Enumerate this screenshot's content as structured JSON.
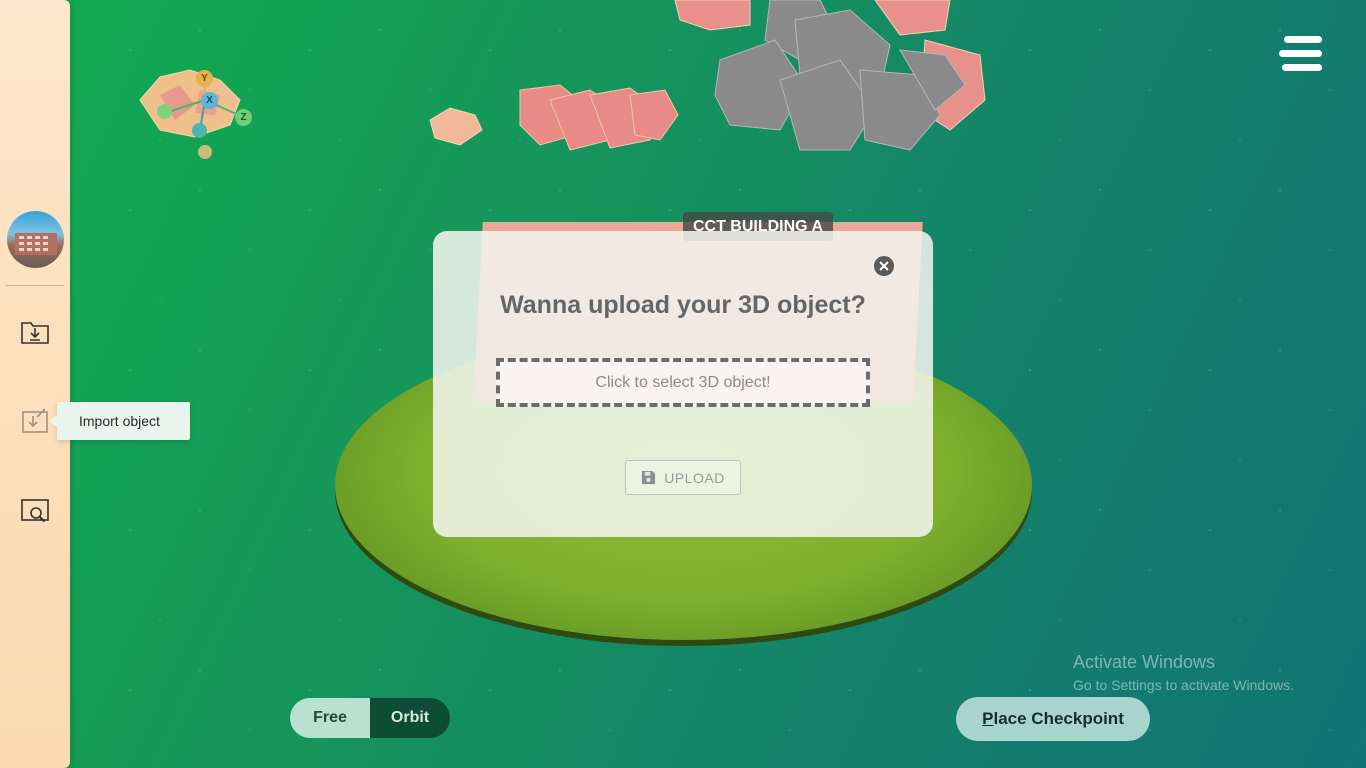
{
  "scene": {
    "building_label": "CCT BUILDING A",
    "gizmo": {
      "y": "Y",
      "x": "X",
      "z": "Z"
    }
  },
  "sidebar": {
    "avatar": "building-avatar",
    "items": [
      {
        "icon": "folder-download-icon"
      },
      {
        "icon": "import-object-icon",
        "tooltip": "Import object"
      },
      {
        "icon": "search-object-icon"
      }
    ]
  },
  "dialog": {
    "title": "Wanna upload your 3D object?",
    "drop_zone_text": "Click to select 3D object!",
    "upload_label": "UPLOAD"
  },
  "bottom": {
    "mode_free": "Free",
    "mode_orbit": "Orbit",
    "active_mode": "Orbit",
    "checkpoint_first_letter": "P",
    "checkpoint_rest": "lace Checkpoint"
  },
  "watermark": {
    "title": "Activate Windows",
    "subtitle": "Go to Settings to activate Windows."
  },
  "colors": {
    "sidebar_bg": "#fde6c9",
    "orbit_active": "#0d4c35",
    "free_inactive": "#b7e2d2",
    "checkpoint_bg": "#a9d4ce"
  }
}
